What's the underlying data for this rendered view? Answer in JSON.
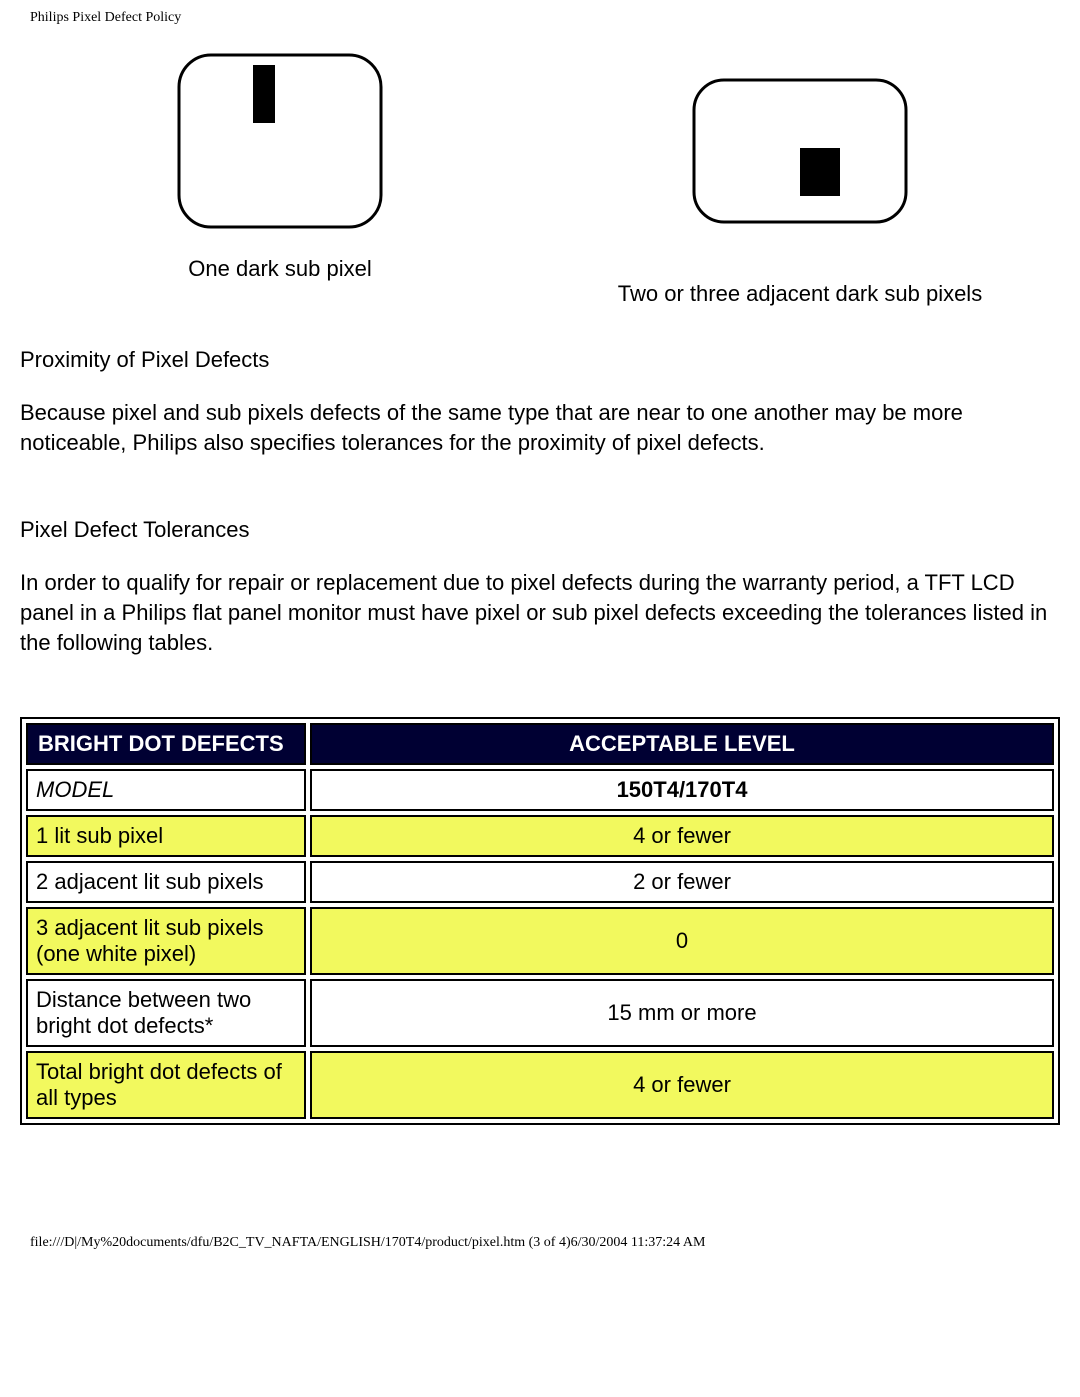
{
  "header": "Philips Pixel Defect Policy",
  "illus": {
    "left_caption": "One dark sub pixel",
    "right_caption": "Two or three adjacent dark sub pixels"
  },
  "section1": {
    "title": "Proximity of Pixel Defects",
    "body": "Because pixel and sub pixels defects of the same type that are near to one another may be more noticeable, Philips also specifies tolerances for the proximity of pixel defects."
  },
  "section2": {
    "title": "Pixel Defect Tolerances",
    "body": "In order to qualify for repair or replacement due to pixel defects during the warranty period, a TFT LCD panel in a Philips flat panel monitor must have pixel or sub pixel defects exceeding the tolerances listed in the following tables."
  },
  "table": {
    "head_left": "BRIGHT DOT DEFECTS",
    "head_right": "ACCEPTABLE LEVEL",
    "model_label": "MODEL",
    "model_value": "150T4/170T4",
    "rows": [
      {
        "label": "1 lit sub pixel",
        "value": "4 or fewer"
      },
      {
        "label": "2 adjacent lit sub pixels",
        "value": "2 or fewer"
      },
      {
        "label": "3 adjacent lit sub pixels (one white pixel)",
        "value": "0"
      },
      {
        "label": "Distance between two bright dot defects*",
        "value": "15 mm or more"
      },
      {
        "label": "Total bright dot defects of all types",
        "value": "4 or fewer"
      }
    ]
  },
  "footer": "file:///D|/My%20documents/dfu/B2C_TV_NAFTA/ENGLISH/170T4/product/pixel.htm (3 of 4)6/30/2004 11:37:24 AM"
}
